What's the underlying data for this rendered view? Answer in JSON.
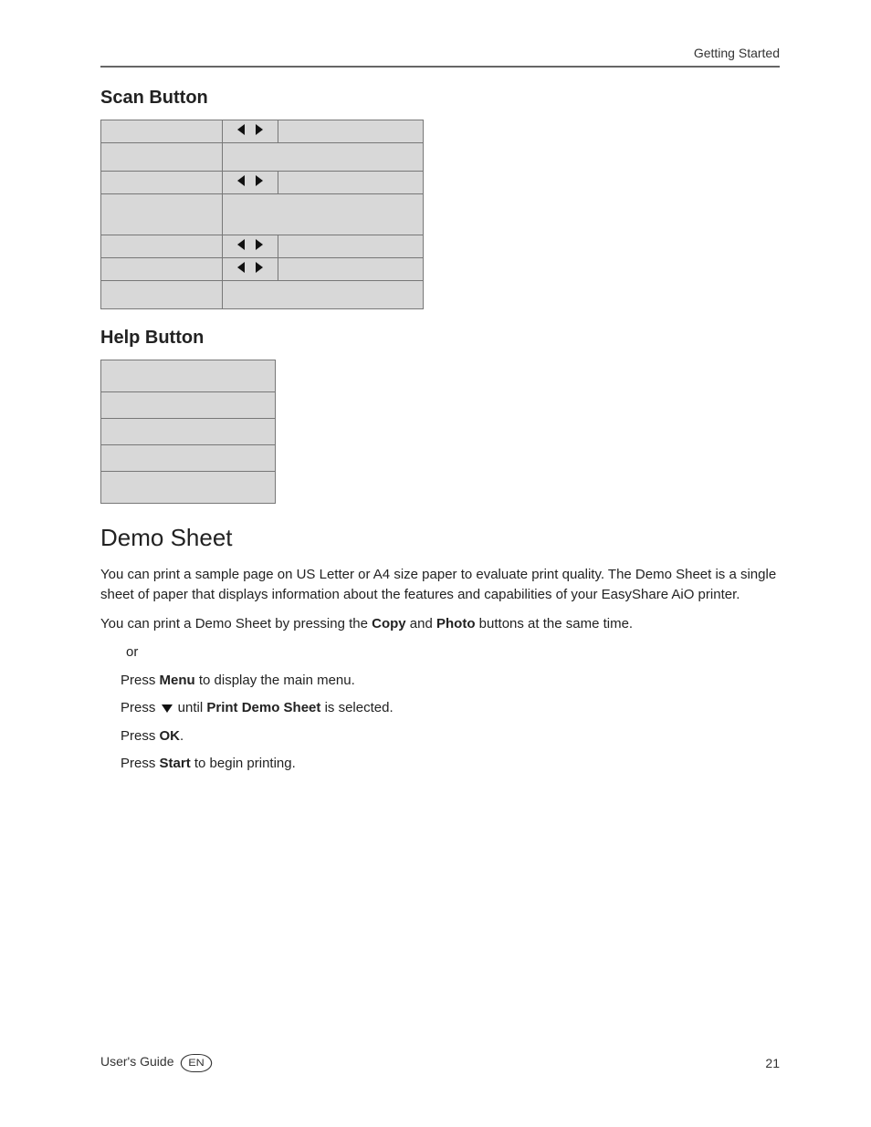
{
  "header": {
    "section": "Getting Started"
  },
  "headings": {
    "scan": "Scan Button",
    "help": "Help Button",
    "demo": "Demo Sheet"
  },
  "scan_table": {
    "rows": [
      {
        "has_arrows": true,
        "subrow": true
      },
      {
        "has_arrows": true,
        "subrow": true
      },
      {
        "has_arrows": true,
        "subrow": false
      },
      {
        "has_arrows": true,
        "subrow": true
      }
    ]
  },
  "help_table": {
    "row_count": 5
  },
  "demo": {
    "para1": "You can print a sample page on US Letter or A4 size paper to evaluate print quality. The Demo Sheet is a single sheet of paper that displays information about the features and capabilities of your EasyShare AiO printer.",
    "para2_pre": "You can print a Demo Sheet by pressing the ",
    "para2_b1": "Copy",
    "para2_mid": " and ",
    "para2_b2": "Photo",
    "para2_post": " buttons at the same time.",
    "steps": {
      "s0": "or",
      "s1_pre": "Press ",
      "s1_b": "Menu",
      "s1_post": " to display the main menu.",
      "s2_pre": "Press ",
      "s2_icon": "down",
      "s2_mid": " until ",
      "s2_b": "Print Demo Sheet",
      "s2_post": " is selected.",
      "s3_pre": "Press ",
      "s3_b": "OK",
      "s3_post": ".",
      "s4_pre": "Press ",
      "s4_b": "Start",
      "s4_post": " to begin printing."
    }
  },
  "footer": {
    "guide": "User's Guide",
    "lang": "EN",
    "page": "21"
  }
}
